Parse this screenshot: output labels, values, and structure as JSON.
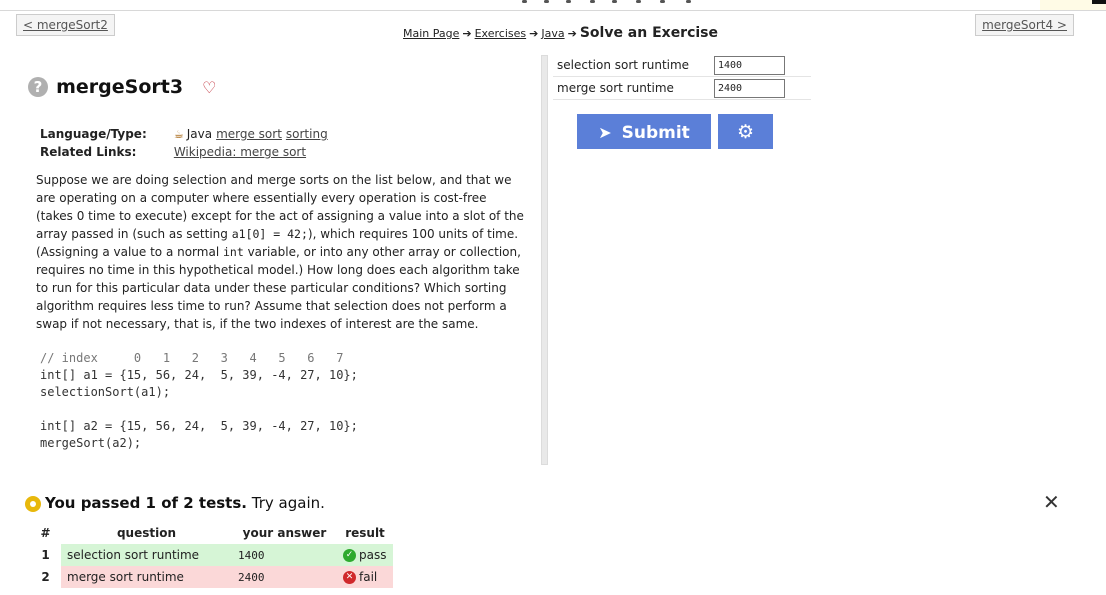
{
  "nav": {
    "prev_label": "< mergeSort2",
    "next_label": "mergeSort4 >"
  },
  "breadcrumb": {
    "items": [
      "Main Page",
      "Exercises",
      "Java"
    ],
    "current": "Solve an Exercise"
  },
  "problem": {
    "help_glyph": "?",
    "title": "mergeSort3",
    "language_key": "Language/Type:",
    "language": "Java",
    "tags": [
      "merge sort",
      "sorting"
    ],
    "related_key": "Related Links:",
    "related_link": "Wikipedia: merge sort"
  },
  "description": {
    "p1": "Suppose we are doing selection and merge sorts on the list below, and that we are operating on a computer where essentially every operation is cost-free (takes 0 time to execute) except for the act of assigning a value into a slot of the array passed in (such as setting ",
    "code1": "a1[0] = 42;",
    "p2": "), which requires 100 units of time. (Assigning a value to a normal ",
    "code2": "int",
    "p3": " variable, or into any other array or collection, requires no time in this hypothetical model.) How long does each algorithm take to run for this particular data under these particular conditions? Which sorting algorithm requires less time to run? Assume that selection does not perform a swap if not necessary, that is, if the two indexes of interest are the same."
  },
  "code": {
    "line1": "// index     0   1   2   3   4   5   6   7",
    "line2": "int[] a1 = {15, 56, 24,  5, 39, -4, 27, 10};",
    "line3": "selectionSort(a1);",
    "line4": "int[] a2 = {15, 56, 24,  5, 39, -4, 27, 10};",
    "line5": "mergeSort(a2);"
  },
  "answers": [
    {
      "label": "selection sort runtime",
      "value": "1400"
    },
    {
      "label": "merge sort runtime",
      "value": "2400"
    }
  ],
  "buttons": {
    "submit_label": "Submit"
  },
  "result": {
    "summary": "You passed 1 of 2 tests.",
    "hint": "Try again.",
    "close_glyph": "✕",
    "headers": [
      "#",
      "question",
      "your answer",
      "result"
    ],
    "rows": [
      {
        "num": "1",
        "question": "selection sort runtime",
        "answer": "1400",
        "result": "pass"
      },
      {
        "num": "2",
        "question": "merge sort runtime",
        "answer": "2400",
        "result": "fail"
      }
    ]
  },
  "colors": {
    "button": "#5b7fd8",
    "pass_bg": "#d6f5d6",
    "fail_bg": "#fbd8d8",
    "pass": "#2eaa2e",
    "fail": "#d0292c",
    "warn": "#e8b80c"
  }
}
